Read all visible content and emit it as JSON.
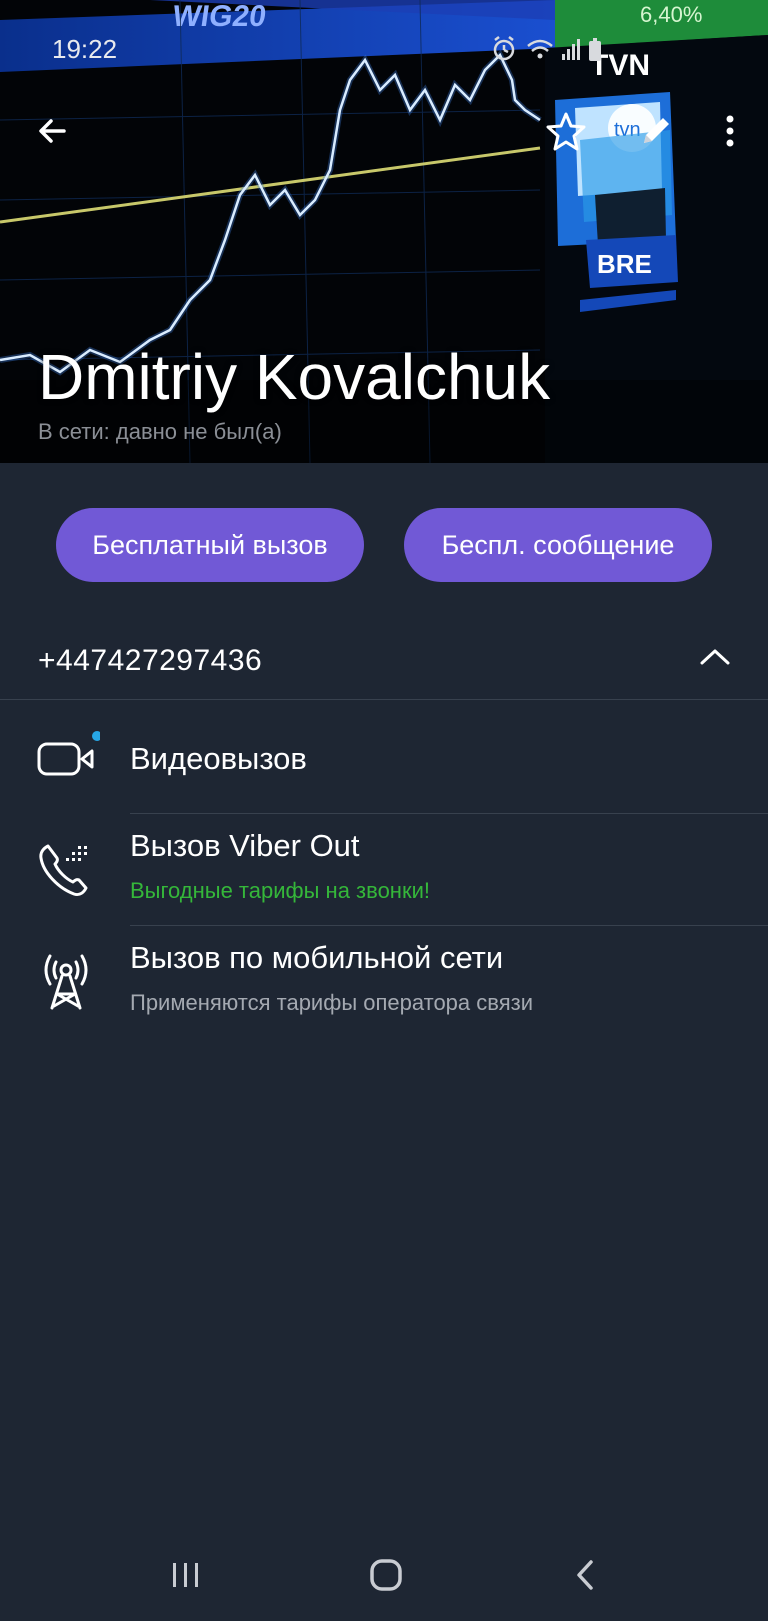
{
  "status_bar": {
    "time": "19:22",
    "icons": [
      "alarm-icon",
      "wifi-icon",
      "signal-icon",
      "battery-icon"
    ]
  },
  "header": {
    "background": "stock-chart-photo",
    "background_texts": {
      "ticker": "WIG20",
      "change": "6,40%",
      "channel": "TVN",
      "channel_logo": "tvn",
      "banner": "BRE"
    },
    "icons": [
      "back-arrow-icon",
      "star-icon",
      "pencil-icon",
      "more-vert-icon"
    ]
  },
  "contact": {
    "name": "Dmitriy Kovalchuk",
    "status": "В сети: давно не был(а)"
  },
  "actions": {
    "free_call": "Бесплатный вызов",
    "free_message": "Беспл. сообщение"
  },
  "phone": {
    "number": "+447427297436"
  },
  "options": [
    {
      "title": "Видеовызов",
      "subtitle": "",
      "icon": "video-camera-icon"
    },
    {
      "title": "Вызов Viber Out",
      "subtitle": "Выгодные тарифы на звонки!",
      "icon": "phone-dots-icon"
    },
    {
      "title": "Вызов по мобильной сети",
      "subtitle": "Применяются тарифы оператора связи",
      "icon": "cell-tower-icon"
    }
  ],
  "colors": {
    "background": "#1e2633",
    "accent": "#7159d6",
    "viber_out_green": "#35b73a",
    "notification_dot": "#27a7e7",
    "divider": "#38414e"
  },
  "nav_bar": {
    "icons": [
      "recent-apps-icon",
      "home-icon",
      "back-icon"
    ]
  }
}
